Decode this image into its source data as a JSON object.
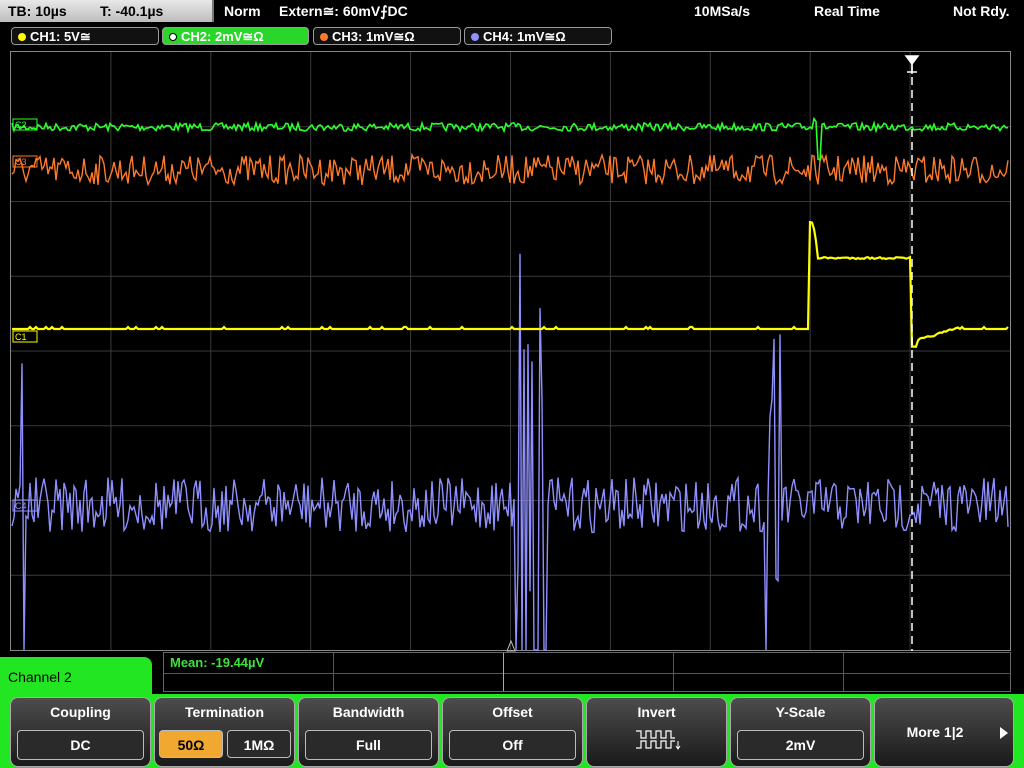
{
  "topbar": {
    "timebase": "TB: 10µs",
    "trigger_time": "T: -40.1µs",
    "trigger_mode": "Norm",
    "trigger_source": "Extern≅: 60mV⨍DC",
    "sample_rate": "10MSa/s",
    "acq_mode": "Real Time",
    "status": "Not Rdy."
  },
  "channels": [
    {
      "label": "CH1: 5V≅",
      "color": "#ffff00"
    },
    {
      "label": "CH2: 2mV≅Ω",
      "color": "#2aff2a"
    },
    {
      "label": "CH3: 1mV≅Ω",
      "color": "#ff7a2a"
    },
    {
      "label": "CH4: 1mV≅Ω",
      "color": "#8f8fff"
    }
  ],
  "markers": {
    "ch1": "C1",
    "ch2": "C2",
    "ch3": "C3",
    "ch4": "C4"
  },
  "measurement": {
    "text": "Mean: -19.44µV"
  },
  "menu": {
    "channel_label": "Channel 2",
    "coupling": {
      "title": "Coupling",
      "value": "DC"
    },
    "termination": {
      "title": "Termination",
      "opt_a": "50Ω",
      "opt_b": "1MΩ"
    },
    "bandwidth": {
      "title": "Bandwidth",
      "value": "Full"
    },
    "offset": {
      "title": "Offset",
      "value": "Off"
    },
    "invert": {
      "title": "Invert"
    },
    "yscale": {
      "title": "Y-Scale",
      "value": "2mV"
    },
    "more": {
      "label": "More 1|2"
    }
  },
  "colors": {
    "accent": "#23e623",
    "ch1": "#ffff00",
    "ch2": "#2aff2a",
    "ch3": "#ff7a2a",
    "ch4": "#8f8fff"
  }
}
